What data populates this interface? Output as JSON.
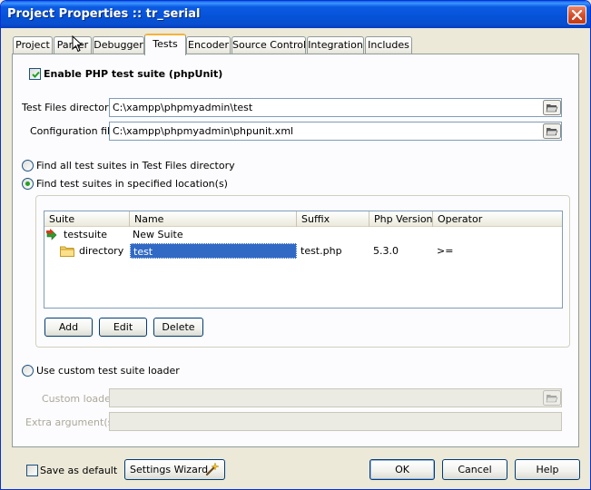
{
  "window": {
    "title": "Project Properties :: tr_serial"
  },
  "tabs": [
    {
      "label": "Project"
    },
    {
      "label": "Parser"
    },
    {
      "label": "Debugger"
    },
    {
      "label": "Tests"
    },
    {
      "label": "Encoder"
    },
    {
      "label": "Source Control"
    },
    {
      "label": "Integration"
    },
    {
      "label": "Includes"
    }
  ],
  "active_tab": "Tests",
  "tests": {
    "enable_label": "Enable PHP test suite (phpUnit)",
    "enable_checked": true,
    "test_files_label": "Test Files directory:",
    "test_files_value": "C:\\xampp\\phpmyadmin\\test",
    "config_label": "Configuration file:",
    "config_value": "C:\\xampp\\phpmyadmin\\phpunit.xml",
    "radio_find_all": "Find all test suites in Test Files directory",
    "radio_find_specified": "Find test suites in specified location(s)",
    "selected_radio": "find_specified",
    "grid": {
      "columns": [
        "Suite",
        "Name",
        "Suffix",
        "Php Version",
        "Operator"
      ],
      "rows": [
        {
          "suite": "testsuite",
          "name": "New Suite",
          "suffix": "",
          "php_version": "",
          "operator": "",
          "icon": "testsuite-icon"
        },
        {
          "suite": "directory",
          "name": "test",
          "suffix": "test.php",
          "php_version": "5.3.0",
          "operator": ">=",
          "icon": "folder-icon"
        }
      ]
    },
    "add_label": "Add",
    "edit_label": "Edit",
    "delete_label": "Delete",
    "radio_custom_loader": "Use custom test suite loader",
    "custom_loader_label": "Custom loader:",
    "custom_loader_value": "",
    "extra_args_label": "Extra argument(s):",
    "extra_args_value": ""
  },
  "footer": {
    "save_default_label": "Save as default",
    "save_default_checked": false,
    "settings_wizard_label": "Settings Wizard",
    "ok_label": "OK",
    "cancel_label": "Cancel",
    "help_label": "Help"
  },
  "colors": {
    "titlebar": "#0552d8",
    "selection": "#316ac5",
    "active_tab_accent": "#f8b238"
  }
}
